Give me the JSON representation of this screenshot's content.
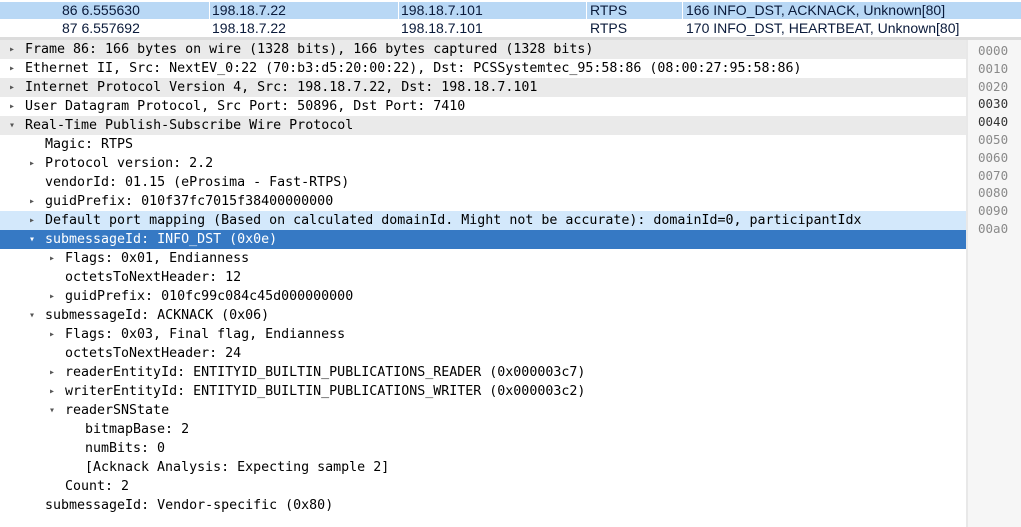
{
  "packet_list": [
    {
      "no_time": "86 6.555630",
      "source": "198.18.7.22",
      "destination": "198.18.7.101",
      "protocol": "RTPS",
      "info": "166 INFO_DST, ACKNACK, Unknown[80]"
    },
    {
      "no_time": "87 6.557692",
      "source": "198.18.7.22",
      "destination": "198.18.7.101",
      "protocol": "RTPS",
      "info": "170 INFO_DST, HEARTBEAT, Unknown[80]"
    }
  ],
  "tree": [
    {
      "indent": 0,
      "expander": "collapsed",
      "text": "Frame 86: 166 bytes on wire (1328 bits), 166 bytes captured (1328 bits)",
      "style": "alt"
    },
    {
      "indent": 0,
      "expander": "collapsed",
      "text": "Ethernet II, Src: NextEV_0:22 (70:b3:d5:20:00:22), Dst: PCSSystemtec_95:58:86 (08:00:27:95:58:86)",
      "style": "normal"
    },
    {
      "indent": 0,
      "expander": "collapsed",
      "text": "Internet Protocol Version 4, Src: 198.18.7.22, Dst: 198.18.7.101",
      "style": "alt"
    },
    {
      "indent": 0,
      "expander": "collapsed",
      "text": "User Datagram Protocol, Src Port: 50896, Dst Port: 7410",
      "style": "normal"
    },
    {
      "indent": 0,
      "expander": "expanded",
      "text": "Real-Time Publish-Subscribe Wire Protocol",
      "style": "alt"
    },
    {
      "indent": 1,
      "expander": "none",
      "text": "Magic: RTPS",
      "style": "normal"
    },
    {
      "indent": 1,
      "expander": "collapsed",
      "text": "Protocol version: 2.2",
      "style": "normal"
    },
    {
      "indent": 1,
      "expander": "none",
      "text": "vendorId: 01.15 (eProsima - Fast-RTPS)",
      "style": "normal"
    },
    {
      "indent": 1,
      "expander": "collapsed",
      "text": "guidPrefix: 010f37fc7015f38400000000",
      "style": "normal"
    },
    {
      "indent": 1,
      "expander": "collapsed",
      "text": "Default port mapping (Based on calculated domainId. Might not be accurate): domainId=0, participantIdx",
      "style": "hl"
    },
    {
      "indent": 1,
      "expander": "expanded",
      "text": "submessageId: INFO_DST (0x0e)",
      "style": "sel"
    },
    {
      "indent": 2,
      "expander": "collapsed",
      "text": "Flags: 0x01, Endianness",
      "style": "normal"
    },
    {
      "indent": 2,
      "expander": "none",
      "text": "octetsToNextHeader: 12",
      "style": "normal"
    },
    {
      "indent": 2,
      "expander": "collapsed",
      "text": "guidPrefix: 010fc99c084c45d000000000",
      "style": "normal"
    },
    {
      "indent": 1,
      "expander": "expanded",
      "text": "submessageId: ACKNACK (0x06)",
      "style": "normal"
    },
    {
      "indent": 2,
      "expander": "collapsed",
      "text": "Flags: 0x03, Final flag, Endianness",
      "style": "normal"
    },
    {
      "indent": 2,
      "expander": "none",
      "text": "octetsToNextHeader: 24",
      "style": "normal"
    },
    {
      "indent": 2,
      "expander": "collapsed",
      "text": "readerEntityId: ENTITYID_BUILTIN_PUBLICATIONS_READER (0x000003c7)",
      "style": "normal"
    },
    {
      "indent": 2,
      "expander": "collapsed",
      "text": "writerEntityId: ENTITYID_BUILTIN_PUBLICATIONS_WRITER (0x000003c2)",
      "style": "normal"
    },
    {
      "indent": 2,
      "expander": "expanded",
      "text": "readerSNState",
      "style": "normal"
    },
    {
      "indent": 3,
      "expander": "none",
      "text": "bitmapBase: 2",
      "style": "normal"
    },
    {
      "indent": 3,
      "expander": "none",
      "text": "numBits: 0",
      "style": "normal"
    },
    {
      "indent": 3,
      "expander": "none",
      "text": "[Acknack Analysis: Expecting sample 2]",
      "style": "normal"
    },
    {
      "indent": 2,
      "expander": "none",
      "text": "Count: 2",
      "style": "normal"
    },
    {
      "indent": 1,
      "expander": "none",
      "text": "submessageId: Vendor-specific (0x80)",
      "style": "normal"
    }
  ],
  "hex_offsets": [
    {
      "text": "0000",
      "dark": false
    },
    {
      "text": "0010",
      "dark": false
    },
    {
      "text": "0020",
      "dark": false
    },
    {
      "text": "0030",
      "dark": true
    },
    {
      "text": "0040",
      "dark": true
    },
    {
      "text": "0050",
      "dark": false
    },
    {
      "text": "0060",
      "dark": false
    },
    {
      "text": "0070",
      "dark": false
    },
    {
      "text": "0080",
      "dark": false
    },
    {
      "text": "0090",
      "dark": false
    },
    {
      "text": "00a0",
      "dark": false
    }
  ],
  "icons": {
    "collapsed": "triangle-right-icon",
    "expanded": "triangle-down-icon"
  }
}
